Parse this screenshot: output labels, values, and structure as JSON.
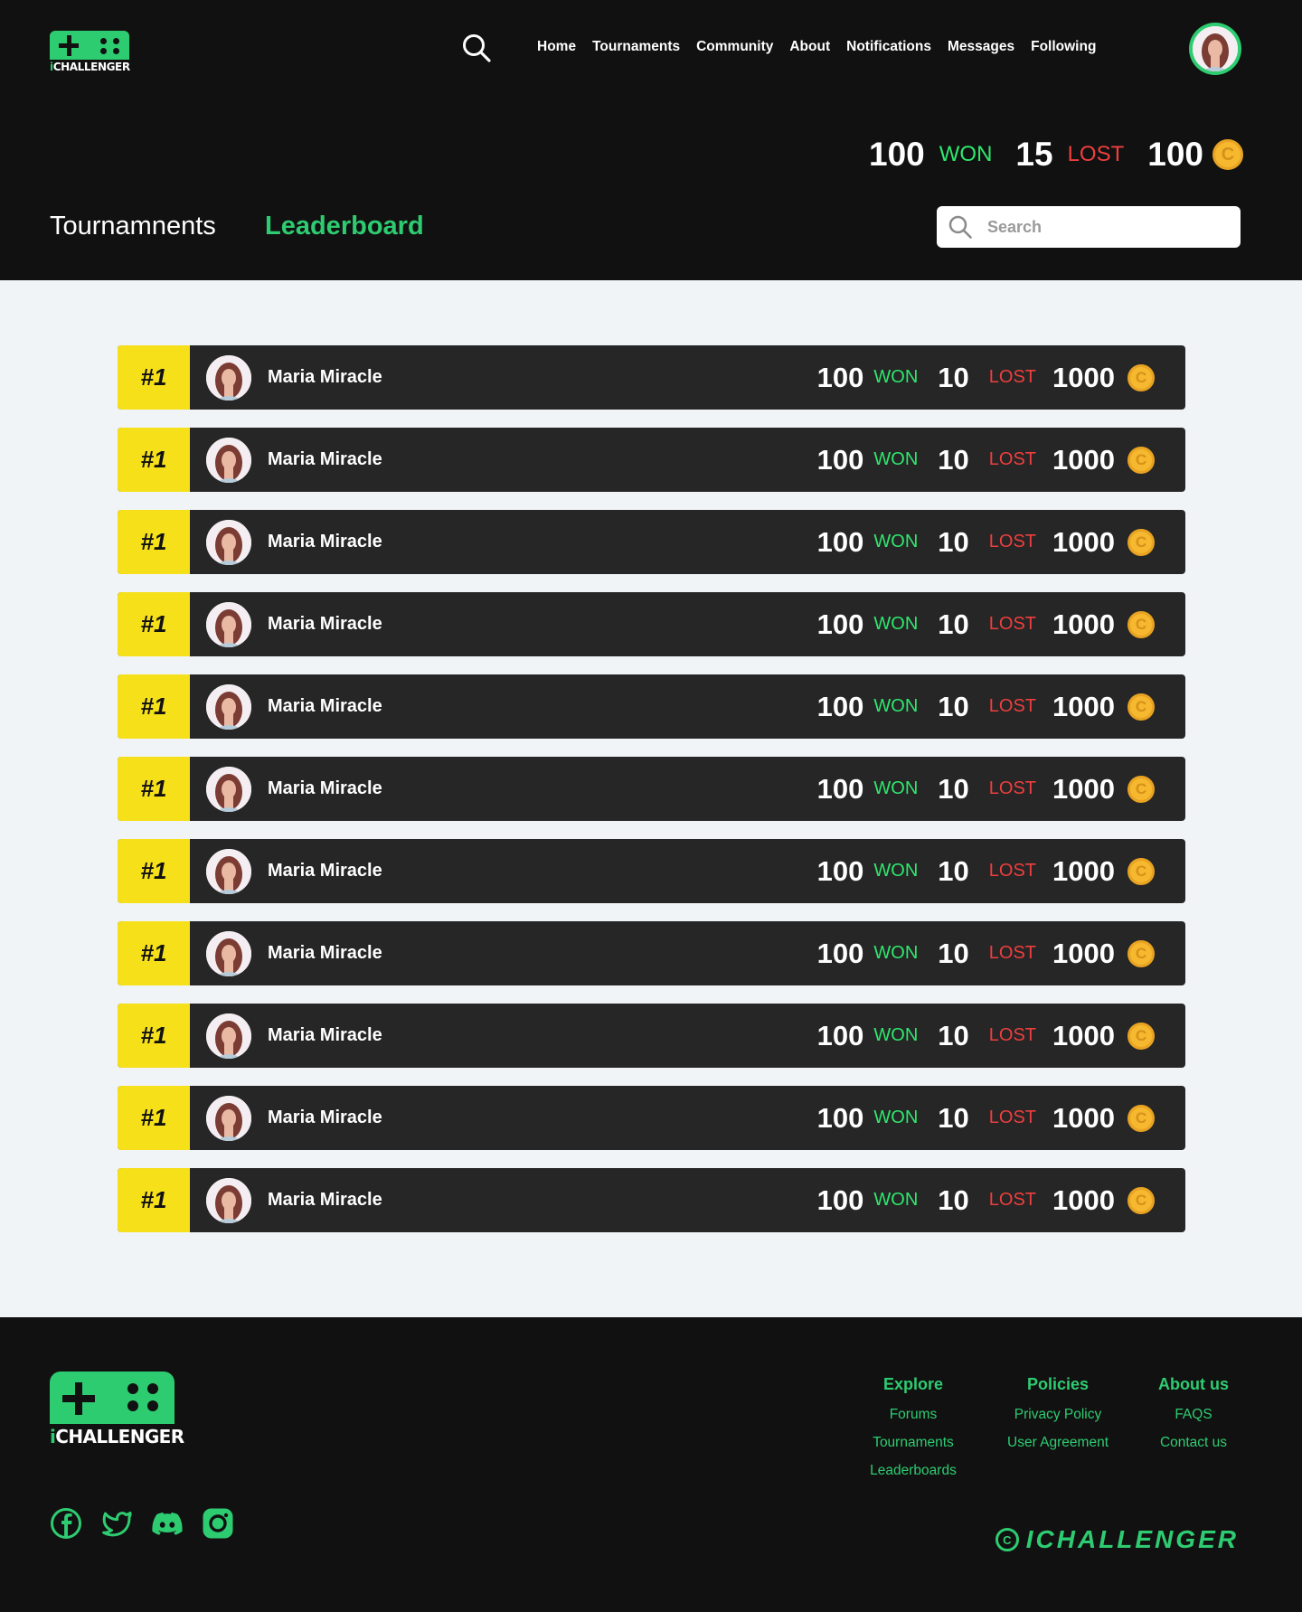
{
  "brand": {
    "logo_prefix": "i",
    "logo_name": "CHALLENGER",
    "copyright_text": "ICHALLENGER",
    "accent": "#2ecc71"
  },
  "nav": {
    "items": [
      {
        "label": "Home"
      },
      {
        "label": "Tournaments"
      },
      {
        "label": "Community"
      },
      {
        "label": "About"
      },
      {
        "label": "Notifications"
      },
      {
        "label": "Messages"
      },
      {
        "label": "Following"
      }
    ]
  },
  "user_stats": {
    "won_count": "100",
    "won_label": "WON",
    "lost_count": "15",
    "lost_label": "LOST",
    "coins": "100",
    "coin_symbol": "C"
  },
  "tabs": {
    "tournaments": "Tournamnents",
    "leaderboard": "Leaderboard"
  },
  "search": {
    "placeholder": "Search"
  },
  "leaderboard": {
    "rows": [
      {
        "rank": "#1",
        "name": "Maria Miracle",
        "won": "100",
        "won_label": "WON",
        "lost": "10",
        "lost_label": "LOST",
        "coins": "1000",
        "coin_symbol": "C"
      },
      {
        "rank": "#1",
        "name": "Maria Miracle",
        "won": "100",
        "won_label": "WON",
        "lost": "10",
        "lost_label": "LOST",
        "coins": "1000",
        "coin_symbol": "C"
      },
      {
        "rank": "#1",
        "name": "Maria Miracle",
        "won": "100",
        "won_label": "WON",
        "lost": "10",
        "lost_label": "LOST",
        "coins": "1000",
        "coin_symbol": "C"
      },
      {
        "rank": "#1",
        "name": "Maria Miracle",
        "won": "100",
        "won_label": "WON",
        "lost": "10",
        "lost_label": "LOST",
        "coins": "1000",
        "coin_symbol": "C"
      },
      {
        "rank": "#1",
        "name": "Maria Miracle",
        "won": "100",
        "won_label": "WON",
        "lost": "10",
        "lost_label": "LOST",
        "coins": "1000",
        "coin_symbol": "C"
      },
      {
        "rank": "#1",
        "name": "Maria Miracle",
        "won": "100",
        "won_label": "WON",
        "lost": "10",
        "lost_label": "LOST",
        "coins": "1000",
        "coin_symbol": "C"
      },
      {
        "rank": "#1",
        "name": "Maria Miracle",
        "won": "100",
        "won_label": "WON",
        "lost": "10",
        "lost_label": "LOST",
        "coins": "1000",
        "coin_symbol": "C"
      },
      {
        "rank": "#1",
        "name": "Maria Miracle",
        "won": "100",
        "won_label": "WON",
        "lost": "10",
        "lost_label": "LOST",
        "coins": "1000",
        "coin_symbol": "C"
      },
      {
        "rank": "#1",
        "name": "Maria Miracle",
        "won": "100",
        "won_label": "WON",
        "lost": "10",
        "lost_label": "LOST",
        "coins": "1000",
        "coin_symbol": "C"
      },
      {
        "rank": "#1",
        "name": "Maria Miracle",
        "won": "100",
        "won_label": "WON",
        "lost": "10",
        "lost_label": "LOST",
        "coins": "1000",
        "coin_symbol": "C"
      },
      {
        "rank": "#1",
        "name": "Maria Miracle",
        "won": "100",
        "won_label": "WON",
        "lost": "10",
        "lost_label": "LOST",
        "coins": "1000",
        "coin_symbol": "C"
      }
    ]
  },
  "footer": {
    "explore": {
      "title": "Explore",
      "links": [
        "Forums",
        "Tournaments",
        "Leaderboards"
      ]
    },
    "policies": {
      "title": "Policies",
      "links": [
        "Privacy Policy",
        "User Agreement"
      ]
    },
    "about": {
      "title": "About us",
      "links": [
        "FAQS",
        "Contact us"
      ]
    },
    "socials": [
      "facebook-icon",
      "twitter-icon",
      "discord-icon",
      "instagram-icon"
    ],
    "copyright_symbol": "C"
  }
}
